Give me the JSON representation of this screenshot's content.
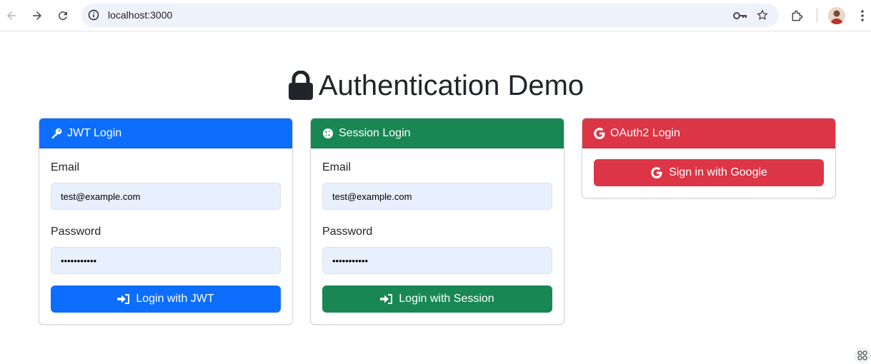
{
  "browser": {
    "url": "localhost:3000"
  },
  "page": {
    "title": "Authentication Demo"
  },
  "cards": {
    "jwt": {
      "header": "JWT Login",
      "email_label": "Email",
      "email_value": "test@example.com",
      "password_label": "Password",
      "password_value": "•••••••••••",
      "button_label": "Login with JWT",
      "color": "#0d6efd"
    },
    "session": {
      "header": "Session Login",
      "email_label": "Email",
      "email_value": "test@example.com",
      "password_label": "Password",
      "password_value": "•••••••••••",
      "button_label": "Login with Session",
      "color": "#198754"
    },
    "oauth": {
      "header": "OAuth2 Login",
      "button_label": "Sign in with Google",
      "color": "#dc3545"
    }
  },
  "icons": {
    "back": "back-arrow-icon",
    "forward": "forward-arrow-icon",
    "reload": "reload-icon",
    "site_info": "info-icon",
    "password_key": "key-icon",
    "bookmark": "star-icon",
    "extensions": "puzzle-icon",
    "menu": "kebab-menu-icon",
    "title": "lock-icon",
    "jwt_header": "key-icon",
    "session_header": "cookie-icon",
    "oauth_header": "google-icon",
    "login": "sign-in-icon"
  }
}
